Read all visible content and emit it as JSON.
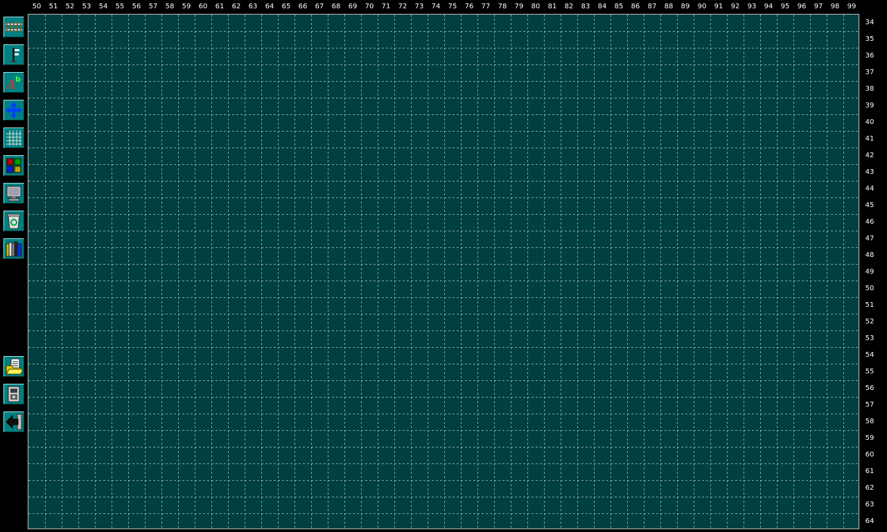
{
  "ruler": {
    "columns": [
      "50",
      "51",
      "52",
      "53",
      "54",
      "55",
      "56",
      "57",
      "58",
      "59",
      "60",
      "61",
      "62",
      "63",
      "64",
      "65",
      "66",
      "67",
      "68",
      "69",
      "70",
      "71",
      "72",
      "73",
      "74",
      "75",
      "76",
      "77",
      "78",
      "79",
      "80",
      "81",
      "82",
      "83",
      "84",
      "85",
      "86",
      "87",
      "88",
      "89",
      "90",
      "91",
      "92",
      "93",
      "94",
      "95",
      "96",
      "97",
      "98",
      "99"
    ],
    "rows": [
      "34",
      "35",
      "36",
      "37",
      "38",
      "39",
      "40",
      "41",
      "42",
      "43",
      "44",
      "45",
      "46",
      "47",
      "48",
      "49",
      "50",
      "51",
      "52",
      "53",
      "54",
      "55",
      "56",
      "57",
      "58",
      "59",
      "60",
      "61",
      "62",
      "63",
      "64"
    ]
  },
  "toolbar": {
    "tools": [
      {
        "icon": "track-icon"
      },
      {
        "icon": "signal-icon"
      },
      {
        "icon": "text-icon"
      },
      {
        "icon": "move-icon"
      },
      {
        "icon": "grid-icon"
      },
      {
        "icon": "palette-icon"
      },
      {
        "icon": "monitor-icon"
      },
      {
        "icon": "recycle-bin-icon"
      },
      {
        "icon": "library-icon"
      },
      {
        "icon": "open-file-icon"
      },
      {
        "icon": "device-icon"
      },
      {
        "icon": "exit-icon"
      }
    ]
  },
  "colors": {
    "canvas_background": "#004040",
    "grid_line": "#b4c8c8",
    "button_face": "#008080",
    "ruler_text": "#ffffff"
  }
}
